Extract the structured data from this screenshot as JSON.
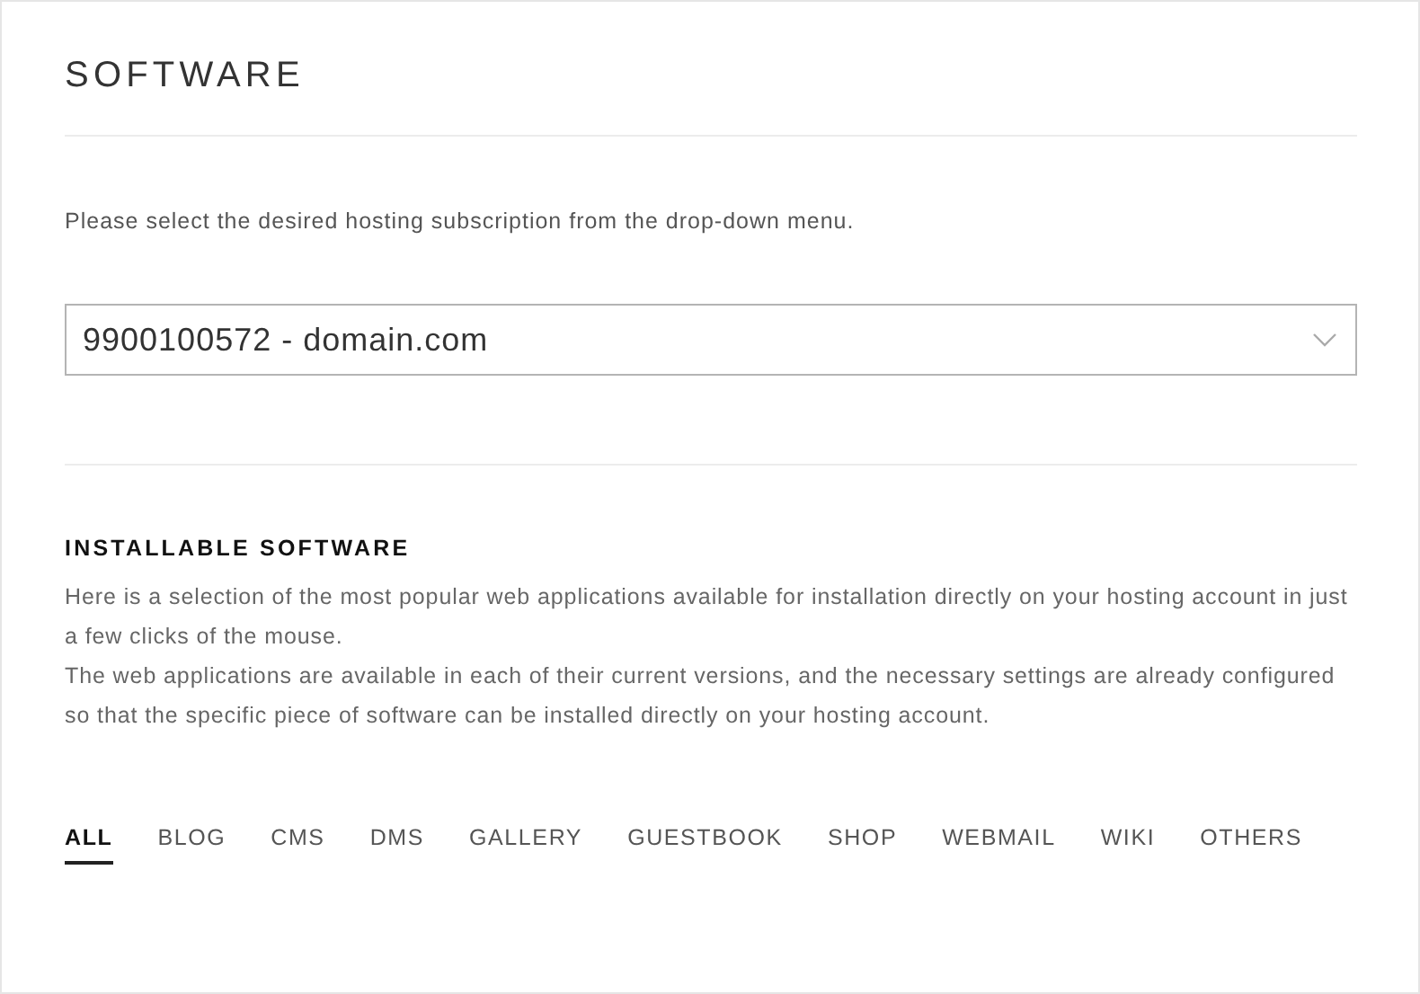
{
  "title": "SOFTWARE",
  "prompt": "Please select the desired hosting subscription from the drop-down menu.",
  "subscription_select": {
    "value": "9900100572 - domain.com"
  },
  "section": {
    "heading": "INSTALLABLE SOFTWARE",
    "paragraphs": [
      "Here is a selection of the most popular web applications available for installation directly on your hosting account in just a few clicks of the mouse.",
      "The web applications are available in each of their current versions, and the necessary settings are already configured so that the specific piece of software can be installed directly on your hosting account."
    ]
  },
  "tabs": [
    {
      "label": "ALL",
      "selected": true
    },
    {
      "label": "BLOG",
      "selected": false
    },
    {
      "label": "CMS",
      "selected": false
    },
    {
      "label": "DMS",
      "selected": false
    },
    {
      "label": "GALLERY",
      "selected": false
    },
    {
      "label": "GUESTBOOK",
      "selected": false
    },
    {
      "label": "SHOP",
      "selected": false
    },
    {
      "label": "WEBMAIL",
      "selected": false
    },
    {
      "label": "WIKI",
      "selected": false
    },
    {
      "label": "OTHERS",
      "selected": false
    }
  ]
}
